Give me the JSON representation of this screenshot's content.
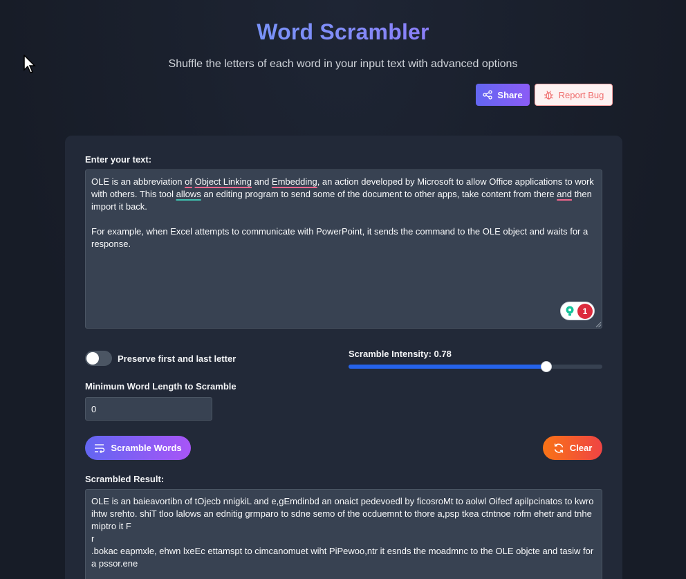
{
  "header": {
    "title": "Word Scrambler",
    "subtitle": "Shuffle the letters of each word in your input text with advanced options",
    "share_label": "Share",
    "report_bug_label": "Report Bug"
  },
  "input": {
    "label": "Enter your text:",
    "seg1": "OLE is an abbreviation ",
    "w_of": "of",
    "seg2": " ",
    "w_object_linking": "Object Linking",
    "seg3": " and ",
    "w_embedding": "Embedding",
    "seg4": ", an action developed by Microsoft to allow Office applications to work with others. This tool ",
    "w_allows": "allows",
    "seg5": " an editing program to send some of the document to other apps, take content from there ",
    "w_and": "and",
    "seg6": " then import it back.\n\nFor example, when Excel attempts to communicate with PowerPoint, it sends the command to the OLE object and waits for a response.",
    "grammar_issue_count": "1"
  },
  "options": {
    "preserve_label": "Preserve first and last letter",
    "preserve_enabled": false,
    "intensity_label": "Scramble Intensity: 0.78",
    "intensity_value": 0.78,
    "min_length_label": "Minimum Word Length to Scramble",
    "min_length_value": "0"
  },
  "actions": {
    "scramble_label": "Scramble Words",
    "clear_label": "Clear"
  },
  "result": {
    "label": "Scrambled Result:",
    "text": "OLE is an baieavortibn of tOjecb nnigkiL and e,gEmdinbd an onaict pedevoedl by ficosroMt to aolwl Oifecf apilpcinatos to kwro ihtw srehto. shiT tloo lalows an ednitig grmparo to sdne semo of the ocduemnt to thore a,psp tkea ctntnoe rofm ehetr and tnhe miptro it F\nr\n.bokac eapmxle, ehwn lxeEc ettamspt to cimcanomuet wiht PiPewoo,ntr it esnds the moadmnc to the OLE objcte and tasiw for a pssor.ene"
  },
  "colors": {
    "accent_blue": "#2563eb",
    "gradient_start": "#6366f1",
    "gradient_end": "#a855f7",
    "clear_start": "#f97316",
    "clear_end": "#ef4444"
  }
}
